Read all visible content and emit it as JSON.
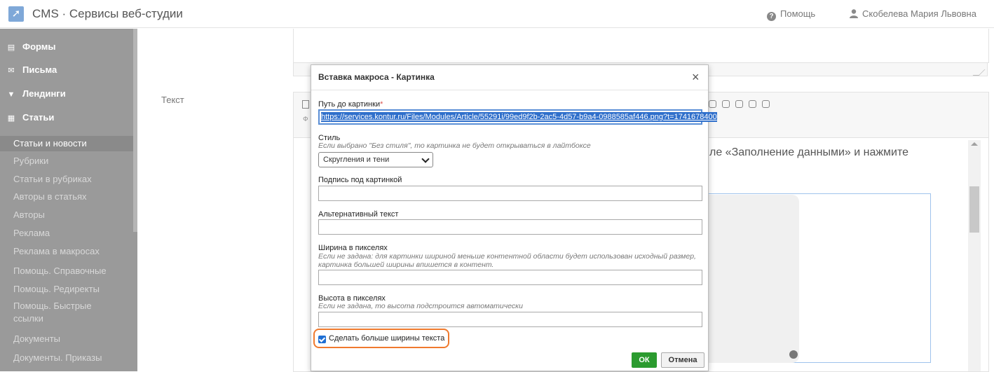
{
  "header": {
    "title": "CMS · Сервисы веб-студии",
    "help_label": "Помощь",
    "user_name": "Скобелева Мария Львовна"
  },
  "sidebar": {
    "sections": [
      {
        "label": "Формы",
        "icon": "database-icon"
      },
      {
        "label": "Письма",
        "icon": "envelope-icon"
      },
      {
        "label": "Лендинги",
        "icon": "filter-icon"
      },
      {
        "label": "Статьи",
        "icon": "document-icon"
      }
    ],
    "items": [
      {
        "label": "Статьи и новости",
        "active": true
      },
      {
        "label": "Рубрики"
      },
      {
        "label": "Статьи в рубриках"
      },
      {
        "label": "Авторы в статьях"
      },
      {
        "label": "Авторы"
      },
      {
        "label": "Реклама"
      },
      {
        "label": "Реклама в макросах"
      },
      {
        "label": "Помощь. Справочные"
      },
      {
        "label": "Помощь. Редиректы"
      },
      {
        "label": "Помощь. Быстрые ссылки"
      },
      {
        "label": "Документы"
      },
      {
        "label": "Документы. Приказы"
      }
    ]
  },
  "form": {
    "text_label": "Текст"
  },
  "editor": {
    "toolbar_fragment": "Ф",
    "paragraph_fragment": "ле «Заполнение данными» и нажмите"
  },
  "modal": {
    "title": "Вставка макроса - Картинка",
    "path_label": "Путь до картинки",
    "path_required_mark": "*",
    "path_value": "https://services.kontur.ru/Files/Modules/Article/55291i/99ed9f2b-2ac5-4d57-b9a4-0988585af446.png?t=1741678400",
    "style_label": "Стиль",
    "style_hint": "Если выбрано \"Без стиля\", то картинка не будет открываться в лайтбоксе",
    "style_selected": "Скругления и тени",
    "caption_label": "Подпись под картинкой",
    "caption_value": "",
    "alt_label": "Альтернативный текст",
    "alt_value": "",
    "width_label": "Ширина в пикселях",
    "width_hint": "Если не задана: для картинки шириной меньше контентной области будет использован исходный размер, картинка большей ширины впишется в контент.",
    "width_value": "",
    "height_label": "Высота в пикселях",
    "height_hint": "Если не задана, то высота подстроится автоматически",
    "height_value": "",
    "wider_checkbox_label": "Сделать больше ширины текста",
    "wider_checked": true,
    "ok_label": "ОК",
    "cancel_label": "Отмена"
  },
  "colors": {
    "sidebar_bg": "#9a9a9a",
    "ok_button": "#2b9b2f",
    "highlight": "#f07a2e",
    "selection": "#2f6fcb"
  }
}
